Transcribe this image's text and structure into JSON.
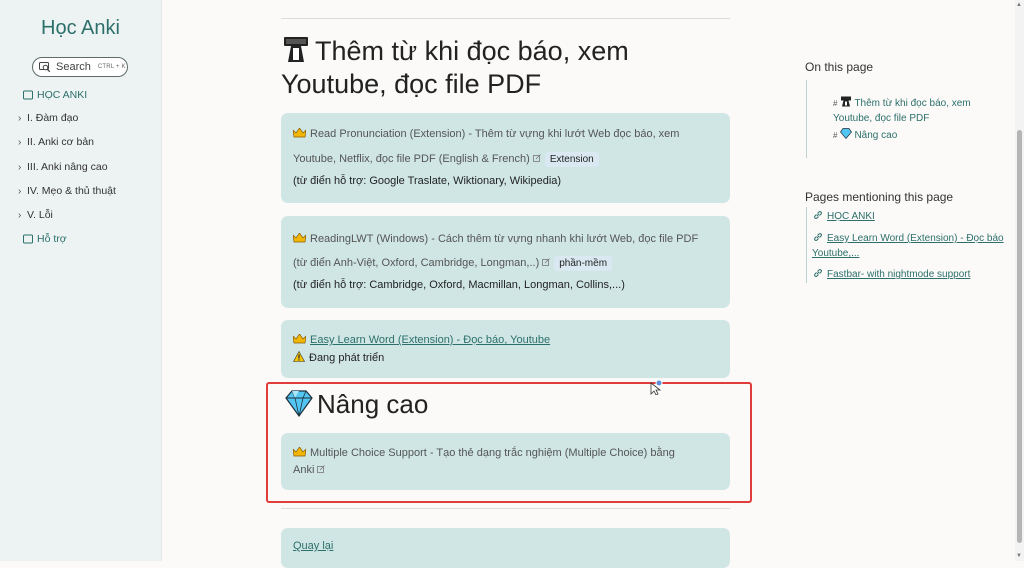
{
  "sidebar": {
    "title": "Học Anki",
    "search_label": "Search",
    "search_shortcut": "CTRL + K",
    "items": [
      {
        "label": "HỌC ANKI",
        "kind": "page"
      },
      {
        "label": "I. Đàm đạo",
        "kind": "folder"
      },
      {
        "label": "II. Anki cơ bản",
        "kind": "folder"
      },
      {
        "label": "III. Anki nâng cao",
        "kind": "folder"
      },
      {
        "label": "IV. Mẹo & thủ thuật",
        "kind": "folder"
      },
      {
        "label": "V. Lỗi",
        "kind": "folder"
      },
      {
        "label": "Hỗ trợ",
        "kind": "page"
      }
    ]
  },
  "main": {
    "heading": "Thêm từ khi đọc báo, xem Youtube, đọc file PDF",
    "cards": [
      {
        "line1": "Read Pronunciation (Extension) - Thêm từ vựng khi lướt Web đọc báo, xem",
        "line2": "Youtube, Netflix, đọc file PDF (English & French)",
        "tag": "Extension",
        "note": "(từ điển hỗ trợ: Google Traslate, Wiktionary, Wikipedia)"
      },
      {
        "line1": "ReadingLWT (Windows) - Cách thêm từ vựng nhanh khi lướt Web, đọc file PDF",
        "line2": "(từ điển Anh-Việt, Oxford, Cambridge, Longman,..)",
        "tag": "phần-mềm",
        "note": "(từ điển hỗ trợ: Cambridge, Oxford, Macmillan, Longman, Collins,...)"
      },
      {
        "link": "Easy Learn Word (Extension) - Đọc báo, Youtube",
        "status": "Đang phát triển"
      }
    ],
    "section2_heading": "Nâng cao",
    "section2_card": {
      "line1": "Multiple Choice Support - Tạo thẻ dạng trắc nghiệm (Multiple Choice) bằng",
      "line2": "Anki"
    },
    "back_link": "Quay lại"
  },
  "toc": {
    "heading": "On this page",
    "items": [
      {
        "hash": "#",
        "label1": "Thêm từ khi đọc báo, xem",
        "label2": "Youtube, đọc file PDF"
      },
      {
        "hash": "#",
        "label1": "Nâng cao"
      }
    ]
  },
  "mentions": {
    "heading": "Pages mentioning this page",
    "items": [
      {
        "label": "HỌC ANKI"
      },
      {
        "label1": "Easy Learn Word (Extension) - Đọc báo",
        "label2": "Youtube,..."
      },
      {
        "label": "Fastbar- with nightmode support"
      }
    ]
  },
  "colors": {
    "accent": "#2c6f6b",
    "card": "#cfe6e5",
    "highlight": "#e03c3c"
  }
}
